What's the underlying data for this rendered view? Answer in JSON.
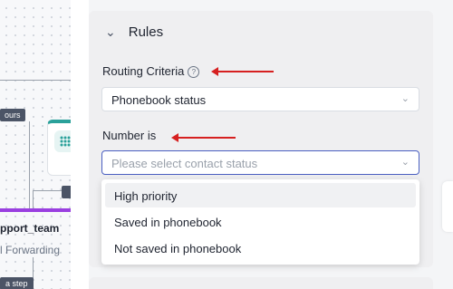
{
  "canvas": {
    "hours_tag": "ours",
    "team_label": "pport_team",
    "forwarding_label": "l Forwarding",
    "step_tag": "a step"
  },
  "rules": {
    "title": "Rules",
    "routing_label": "Routing Criteria",
    "routing_value": "Phonebook status",
    "number_label": "Number is",
    "status_placeholder": "Please select contact status",
    "options": [
      "High priority",
      "Saved in phonebook",
      "Not saved in phonebook"
    ]
  },
  "colors": {
    "accent_focus": "#4a5fc1",
    "annotation_arrow": "#d62020",
    "node_accent": "#2aa19a",
    "flow_bar": "#9a3fe0"
  }
}
